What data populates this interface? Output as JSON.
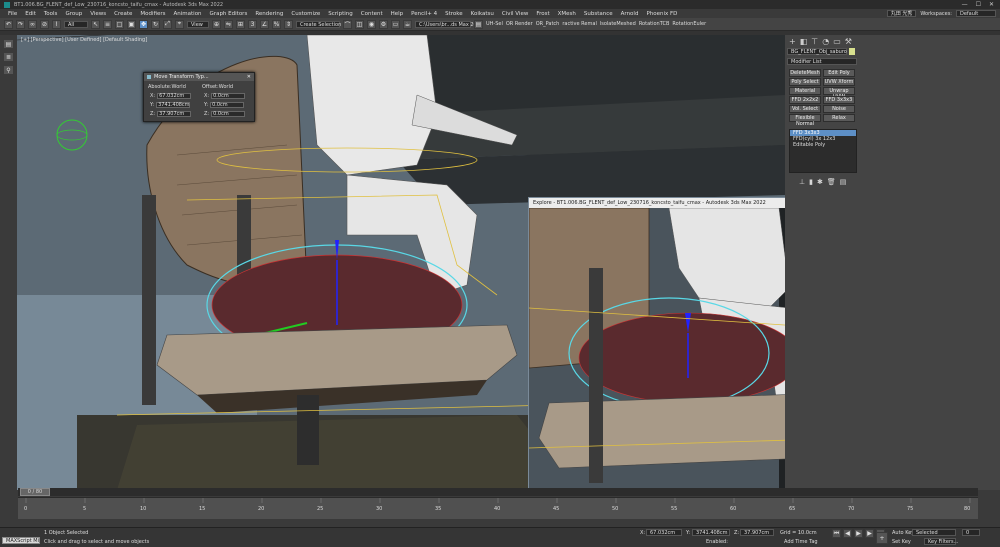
{
  "titlebar": {
    "title": "BT1.006.BG_FLENT_def_Low_230716_koncsto_taifu_cmax - Autodesk 3ds Max 2022",
    "min_icon": "minimize-icon",
    "max_icon": "maximize-icon",
    "close_icon": "close-icon"
  },
  "menubar": {
    "items": [
      "File",
      "Edit",
      "Tools",
      "Group",
      "Views",
      "Create",
      "Modifiers",
      "Animation",
      "Graph Editors",
      "Rendering",
      "Customize",
      "Scripting",
      "Content",
      "Help",
      "Pencil+ 4",
      "Stroke",
      "Koikatsu",
      "Civil View",
      "Frost",
      "XMesh",
      "Substance",
      "Arnold",
      "Phoenix FD"
    ],
    "user": "丸田 光秀",
    "workspaces_label": "Workspaces:",
    "workspace_value": "Default"
  },
  "toolbar": {
    "filter_value": "All",
    "view_value": "View",
    "selection_set": "Create Selection Se",
    "path": "C:\\Users\\br...ds Max 2022",
    "extras": [
      "UH-Sel",
      "OR Render",
      "OR_Patch",
      "ractive Remal",
      "lsolateMeshed",
      "RotationTCB",
      "RotationEuler"
    ]
  },
  "viewport": {
    "label": "[+] [Perspective] [User Defined] [Default Shading]"
  },
  "transform_dialog": {
    "title": "Move Transform Typ...",
    "absolute_label": "Absolute:World",
    "offset_label": "Offset:World",
    "abs": {
      "x": "67.032cm",
      "y": "3741.408cm",
      "z": "37.907cm"
    },
    "off": {
      "x": "0.0cm",
      "y": "0.0cm",
      "z": "0.0cm"
    },
    "axes": [
      "X:",
      "Y:",
      "Z:"
    ]
  },
  "explore_window": {
    "title": "Explore - BT1.006.BG_FLENT_def_Low_230716_koncsto_taifu_cmax - Autodesk 3ds Max 2022"
  },
  "command_panel": {
    "object_name": "BG_FLENT_Obj_saburo",
    "modifier_list": "Modifier List",
    "buttons": [
      "DeleteMesh",
      "Edit Poly",
      "Poly Select",
      "UVW Xform",
      "Material",
      "Unwrap UVW",
      "FFD 2x2x2",
      "FFD 3x3x3",
      "Vol. Select",
      "Noise",
      "Relax",
      "Flip"
    ],
    "normal_label": "Flexible Normal",
    "stack": [
      "FFD 3x3x3",
      "FFD(cyl) 3x 12x3",
      "Editable Poly"
    ]
  },
  "timeline": {
    "slider_label": "0 / 80",
    "ticks": [
      "0",
      "5",
      "10",
      "15",
      "20",
      "25",
      "30",
      "35",
      "40",
      "45",
      "50",
      "55",
      "60",
      "65",
      "70",
      "75",
      "80"
    ]
  },
  "statusbar": {
    "script_label": "MAXScript Mi",
    "objects_selected": "1 Object Selected",
    "hint": "Click and drag to select and move objects",
    "x_label": "X:",
    "x_value": "67.032cm",
    "y_label": "Y:",
    "y_value": "3741.408cm",
    "z_label": "Z:",
    "z_value": "37.907cm",
    "grid": "Grid = 10.0cm",
    "enabled": "Enabled:",
    "add_time_tag": "Add Time Tag",
    "auto_key": "Auto Key",
    "set_key": "Set Key",
    "selected": "Selected",
    "key_filters": "Key Filters...",
    "frame": "0"
  }
}
